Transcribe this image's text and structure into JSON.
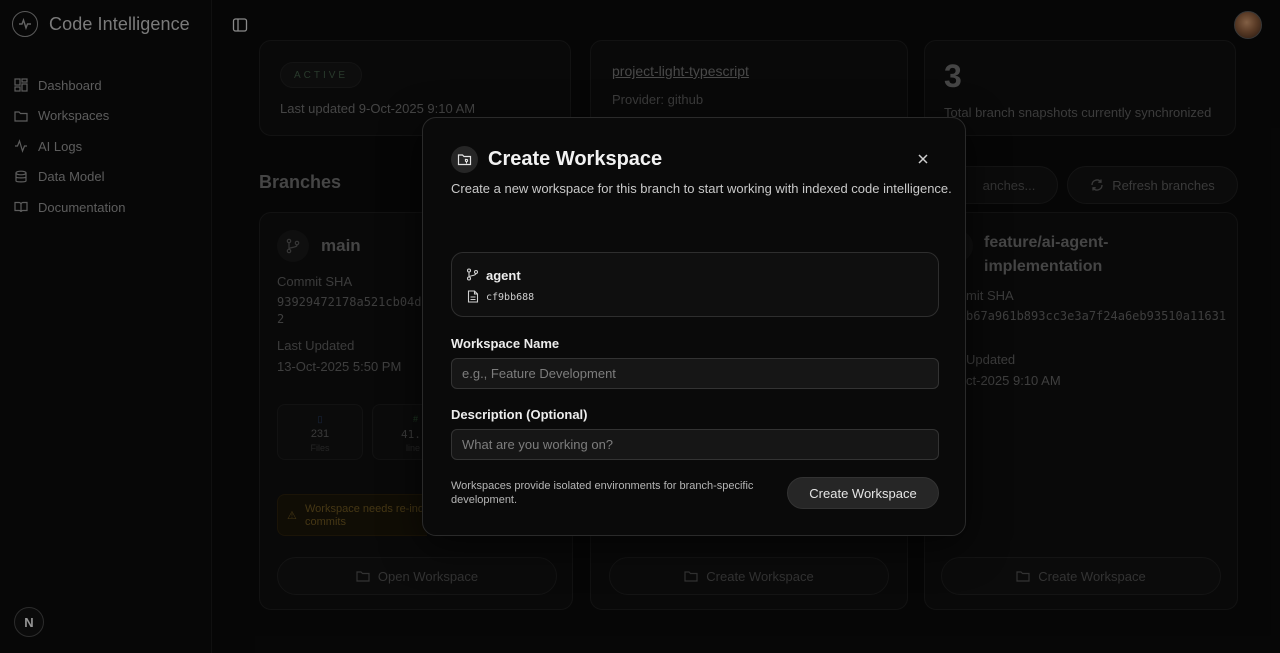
{
  "app": {
    "title": "Code Intelligence",
    "footer_badge": "N"
  },
  "sidebar": {
    "items": [
      {
        "label": "Dashboard",
        "icon": "dashboard-icon"
      },
      {
        "label": "Workspaces",
        "icon": "folder-icon"
      },
      {
        "label": "AI Logs",
        "icon": "activity-icon"
      },
      {
        "label": "Data Model",
        "icon": "database-icon"
      },
      {
        "label": "Documentation",
        "icon": "book-icon"
      }
    ]
  },
  "background": {
    "status": "ACTIVE",
    "last_updated_repo": "Last updated 9-Oct-2025 9:10 AM",
    "repo_name": "project-light-typescript",
    "provider": "Provider: github",
    "snapshot_count": "3",
    "snapshot_label": "Total branch snapshots currently synchronized",
    "branches_heading": "Branches",
    "search_placeholder_fragment": "anches...",
    "refresh_label": "Refresh branches",
    "branch_cards": [
      {
        "name": "main",
        "commit_label": "Commit SHA",
        "commit_sha_line1": "93929472178a521cb04d9",
        "commit_sha_line2": "2",
        "updated_label": "Last Updated",
        "updated_value": "13-Oct-2025 5:50 PM",
        "files_count": "231",
        "files_label": "Files",
        "lines_fragment": "41.",
        "lines_label": "line",
        "warning_line1": "Workspace needs re-ind",
        "warning_line2": "commits",
        "action_label": "Open Workspace"
      },
      {
        "action_label": "Create Workspace"
      },
      {
        "name_line1": "feature/ai-agent-",
        "name_line2": "implementation",
        "commit_label_fragment": "mit SHA",
        "commit_sha_fragment": "b67a961b893cc3e3a7f24a6eb93510a11631",
        "updated_label_fragment": "Updated",
        "updated_value_fragment": "ct-2025 9:10 AM",
        "action_label": "Create Workspace"
      }
    ]
  },
  "modal": {
    "title": "Create Workspace",
    "description": "Create a new workspace for this branch to start working with indexed code intelligence.",
    "branch": {
      "name": "agent",
      "sha": "cf9bb688"
    },
    "name_field": {
      "label": "Workspace Name",
      "value": "",
      "placeholder": "e.g., Feature Development"
    },
    "description_field": {
      "label": "Description (Optional)",
      "value": "",
      "placeholder": "What are you working on?"
    },
    "footnote": "Workspaces provide isolated environments for branch-specific development.",
    "submit_label": "Create Workspace"
  }
}
